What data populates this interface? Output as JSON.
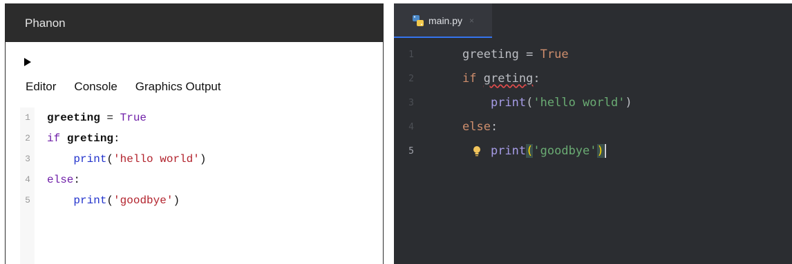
{
  "left": {
    "title": "Phanon",
    "tabs": [
      "Editor",
      "Console",
      "Graphics Output"
    ],
    "code": [
      {
        "n": "1",
        "parts": [
          {
            "t": "greeting",
            "c": "l-var"
          },
          {
            "t": " = ",
            "c": "l-pun"
          },
          {
            "t": "True",
            "c": "l-true"
          }
        ]
      },
      {
        "n": "2",
        "parts": [
          {
            "t": "if",
            "c": "l-kw"
          },
          {
            "t": " ",
            "c": "l-pun"
          },
          {
            "t": "greting",
            "c": "l-var"
          },
          {
            "t": ":",
            "c": "l-pun"
          }
        ]
      },
      {
        "n": "3",
        "parts": [
          {
            "t": "    ",
            "c": "l-pun"
          },
          {
            "t": "print",
            "c": "l-fn"
          },
          {
            "t": "(",
            "c": "l-pun"
          },
          {
            "t": "'hello world'",
            "c": "l-str"
          },
          {
            "t": ")",
            "c": "l-pun"
          }
        ]
      },
      {
        "n": "4",
        "parts": [
          {
            "t": "else",
            "c": "l-kw"
          },
          {
            "t": ":",
            "c": "l-pun"
          }
        ]
      },
      {
        "n": "5",
        "parts": [
          {
            "t": "    ",
            "c": "l-pun"
          },
          {
            "t": "print",
            "c": "l-fn"
          },
          {
            "t": "(",
            "c": "l-pun"
          },
          {
            "t": "'goodbye'",
            "c": "l-str"
          },
          {
            "t": ")",
            "c": "l-pun"
          }
        ]
      }
    ]
  },
  "right": {
    "tab": {
      "label": "main.py",
      "close": "×"
    },
    "code": [
      {
        "n": "1",
        "parts": [
          {
            "t": "greeting",
            "c": "r-var"
          },
          {
            "t": " = ",
            "c": "r-pun"
          },
          {
            "t": "True",
            "c": "r-kw"
          }
        ]
      },
      {
        "n": "2",
        "parts": [
          {
            "t": "if",
            "c": "r-kw"
          },
          {
            "t": " ",
            "c": "r-pun"
          },
          {
            "t": "greting",
            "c": "r-var r-err"
          },
          {
            "t": ":",
            "c": "r-pun"
          }
        ]
      },
      {
        "n": "3",
        "parts": [
          {
            "t": "    ",
            "c": "r-pun"
          },
          {
            "t": "print",
            "c": "r-fn"
          },
          {
            "t": "(",
            "c": "r-pun"
          },
          {
            "t": "'hello world'",
            "c": "r-str"
          },
          {
            "t": ")",
            "c": "r-pun"
          }
        ]
      },
      {
        "n": "4",
        "parts": [
          {
            "t": "else",
            "c": "r-kw"
          },
          {
            "t": ":",
            "c": "r-pun"
          }
        ]
      },
      {
        "n": "5",
        "active": true,
        "bulb": true,
        "parts": [
          {
            "t": "    ",
            "c": "r-pun"
          },
          {
            "t": "print",
            "c": "r-fn"
          },
          {
            "t": "(",
            "c": "r-brace"
          },
          {
            "t": "'goodbye'",
            "c": "r-str"
          },
          {
            "t": ")",
            "c": "r-brace"
          },
          {
            "t": "",
            "c": "r-cursor"
          }
        ]
      }
    ]
  },
  "icons": {
    "run": "play-icon",
    "file": "python-file-icon",
    "close": "close-icon",
    "intention": "lightbulb-icon"
  },
  "colors": {
    "left_titlebar": "#2c2c2c",
    "right_bg": "#2b2d31",
    "tab_underline": "#3574f0",
    "error_underline": "#e04c4c"
  }
}
